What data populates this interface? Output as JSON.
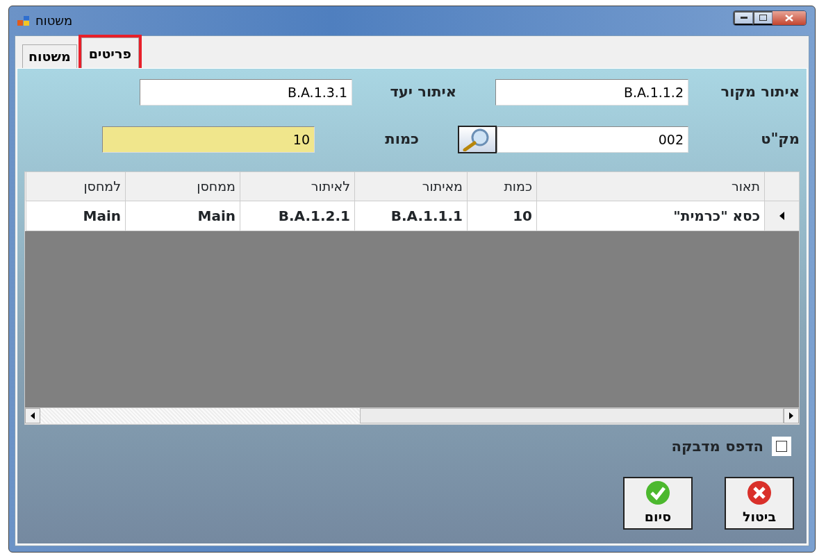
{
  "window": {
    "title": "משטוח"
  },
  "tabs": [
    {
      "label": "משטוח",
      "selected": false,
      "highlighted": false
    },
    {
      "label": "פריטים",
      "selected": true,
      "highlighted": true
    }
  ],
  "fields": [
    {
      "label": "איתור מקור",
      "value": "B.A.1.1.2",
      "kind": "text"
    },
    {
      "label": "איתור יעד",
      "value": "B.A.1.3.1",
      "kind": "text"
    },
    {
      "label": "מק\"ט",
      "value": "002",
      "kind": "lookup"
    },
    {
      "label": "כמות",
      "value": "10",
      "kind": "active"
    }
  ],
  "table": {
    "columns": [
      "תאור",
      "כמות",
      "מאיתור",
      "לאיתור",
      "ממחסן",
      "למחסן"
    ],
    "rows": [
      {
        "cells": [
          "כסא \"כרמית\"",
          "10",
          "B.A.1.1.1",
          "B.A.1.2.1",
          "Main",
          "Main"
        ],
        "selected": true
      }
    ]
  },
  "print_label": {
    "label": "הדפס מדבקה",
    "checked": false
  },
  "buttons": [
    {
      "label": "ביטול",
      "kind": "cancel"
    },
    {
      "label": "סיום",
      "kind": "ok"
    }
  ]
}
